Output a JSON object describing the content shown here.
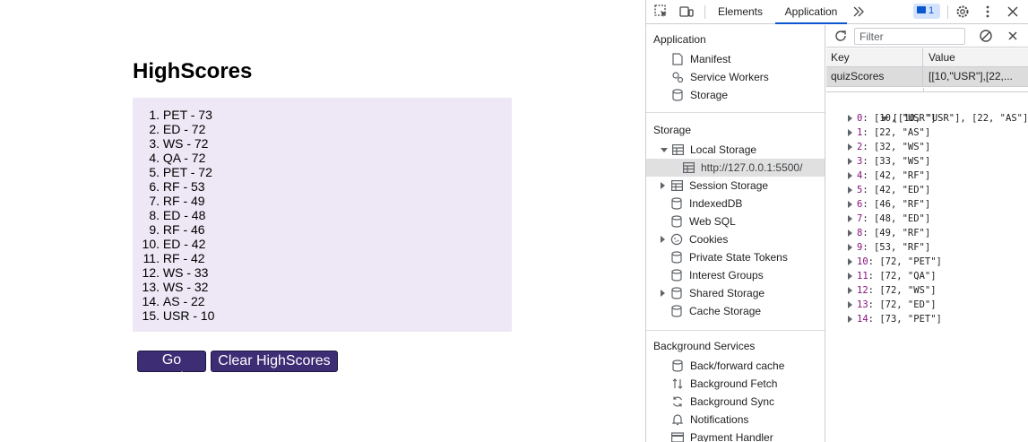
{
  "page": {
    "title": "HighScores",
    "scores": [
      {
        "num": "1.",
        "text": "PET - 73"
      },
      {
        "num": "2.",
        "text": "ED - 72"
      },
      {
        "num": "3.",
        "text": "WS - 72"
      },
      {
        "num": "4.",
        "text": "QA - 72"
      },
      {
        "num": "5.",
        "text": "PET - 72"
      },
      {
        "num": "6.",
        "text": "RF - 53"
      },
      {
        "num": "7.",
        "text": "RF - 49"
      },
      {
        "num": "8.",
        "text": "ED - 48"
      },
      {
        "num": "9.",
        "text": "RF - 46"
      },
      {
        "num": "10.",
        "text": "ED - 42"
      },
      {
        "num": "11.",
        "text": "RF - 42"
      },
      {
        "num": "12.",
        "text": "WS - 33"
      },
      {
        "num": "13.",
        "text": "WS - 32"
      },
      {
        "num": "14.",
        "text": "AS - 22"
      },
      {
        "num": "15.",
        "text": "USR - 10"
      }
    ],
    "buttons": {
      "back": "Go Back",
      "clear": "Clear HighScores"
    },
    "colors": {
      "box_bg": "#ede7f6",
      "button_bg": "#3c2d75"
    }
  },
  "devtools": {
    "tabs": {
      "elements": "Elements",
      "application": "Application"
    },
    "issues_count": "1",
    "sidebar": {
      "application_title": "Application",
      "application_items": [
        "Manifest",
        "Service Workers",
        "Storage"
      ],
      "storage_title": "Storage",
      "local_storage": "Local Storage",
      "origin": "http://127.0.0.1:5500/",
      "storage_items": [
        "Session Storage",
        "IndexedDB",
        "Web SQL",
        "Cookies",
        "Private State Tokens",
        "Interest Groups",
        "Shared Storage",
        "Cache Storage"
      ],
      "background_title": "Background Services",
      "background_items": [
        "Back/forward cache",
        "Background Fetch",
        "Background Sync",
        "Notifications",
        "Payment Handler"
      ]
    },
    "filter_placeholder": "Filter",
    "grid": {
      "key_header": "Key",
      "value_header": "Value",
      "row_key": "quizScores",
      "row_value": "[[10,\"USR\"],[22,..."
    },
    "preview": {
      "root": "[[10, \"USR\"], [22, \"AS\"], [32,",
      "entries": [
        {
          "idx": "0",
          "val": "[10, \"USR\"]"
        },
        {
          "idx": "1",
          "val": "[22, \"AS\"]"
        },
        {
          "idx": "2",
          "val": "[32, \"WS\"]"
        },
        {
          "idx": "3",
          "val": "[33, \"WS\"]"
        },
        {
          "idx": "4",
          "val": "[42, \"RF\"]"
        },
        {
          "idx": "5",
          "val": "[42, \"ED\"]"
        },
        {
          "idx": "6",
          "val": "[46, \"RF\"]"
        },
        {
          "idx": "7",
          "val": "[48, \"ED\"]"
        },
        {
          "idx": "8",
          "val": "[49, \"RF\"]"
        },
        {
          "idx": "9",
          "val": "[53, \"RF\"]"
        },
        {
          "idx": "10",
          "val": "[72, \"PET\"]"
        },
        {
          "idx": "11",
          "val": "[72, \"QA\"]"
        },
        {
          "idx": "12",
          "val": "[72, \"WS\"]"
        },
        {
          "idx": "13",
          "val": "[72, \"ED\"]"
        },
        {
          "idx": "14",
          "val": "[73, \"PET\"]"
        }
      ]
    }
  }
}
